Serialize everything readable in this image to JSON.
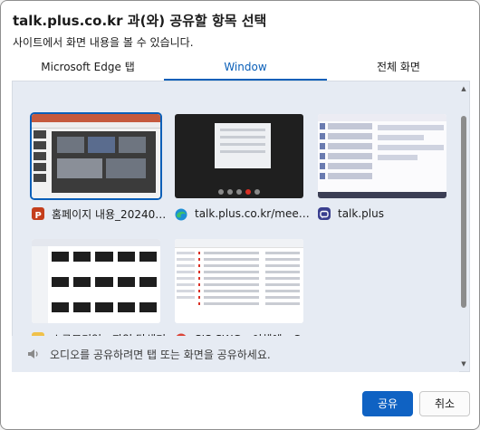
{
  "dialog": {
    "title": "talk.plus.co.kr 과(와) 공유할 항목 선택",
    "subtitle": "사이트에서 화면 내용을 볼 수 있습니다."
  },
  "tabs": [
    {
      "label": "Microsoft Edge 탭",
      "active": false
    },
    {
      "label": "Window",
      "active": true
    },
    {
      "label": "전체 화면",
      "active": false
    }
  ],
  "windows": [
    {
      "label": "홈페이지 내용_2024093...",
      "icon": "powerpoint-icon",
      "selected": true
    },
    {
      "label": "talk.plus.co.kr/meet/ ...",
      "icon": "edge-icon",
      "selected": false
    },
    {
      "label": "talk.plus",
      "icon": "talkplus-icon",
      "selected": false
    },
    {
      "label": "소규모기업 - 파일 탐색기",
      "icon": "folder-icon",
      "selected": false
    },
    {
      "label": "SIS SWG - 이해에 - Ch...",
      "icon": "chrome-icon",
      "selected": false
    }
  ],
  "audio": {
    "text": "오디오를 공유하려면 탭 또는 화면을 공유하세요.",
    "icon": "speaker-icon"
  },
  "buttons": {
    "share": "공유",
    "cancel": "취소"
  },
  "colors": {
    "accent": "#0a5fb8",
    "panel_bg": "#e6ebf3",
    "primary_button": "#0f62c3"
  }
}
